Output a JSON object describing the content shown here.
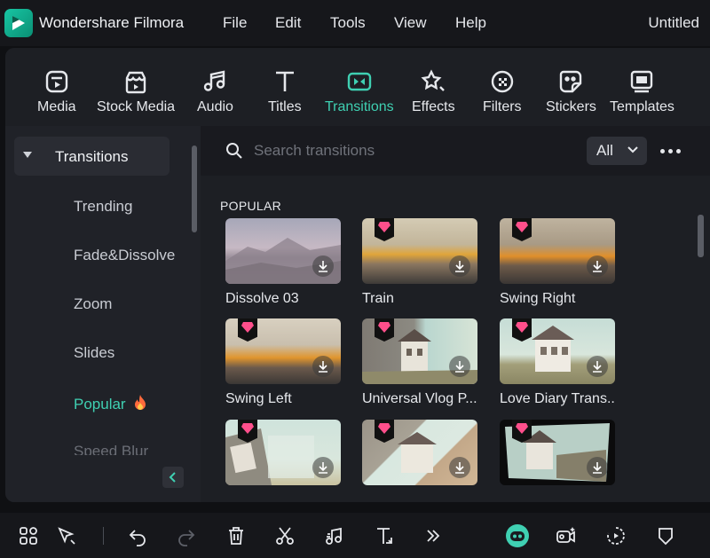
{
  "titlebar": {
    "app_title": "Wondershare Filmora",
    "menu": [
      "File",
      "Edit",
      "Tools",
      "View",
      "Help"
    ],
    "document_title": "Untitled"
  },
  "tabs": [
    {
      "label": "Media",
      "icon": "media-icon",
      "active": false
    },
    {
      "label": "Stock Media",
      "icon": "stock-media-icon",
      "active": false
    },
    {
      "label": "Audio",
      "icon": "audio-icon",
      "active": false
    },
    {
      "label": "Titles",
      "icon": "titles-icon",
      "active": false
    },
    {
      "label": "Transitions",
      "icon": "transitions-icon",
      "active": true
    },
    {
      "label": "Effects",
      "icon": "effects-icon",
      "active": false
    },
    {
      "label": "Filters",
      "icon": "filters-icon",
      "active": false
    },
    {
      "label": "Stickers",
      "icon": "stickers-icon",
      "active": false
    },
    {
      "label": "Templates",
      "icon": "templates-icon",
      "active": false
    }
  ],
  "sidebar": {
    "header": "Transitions",
    "items": [
      "Trending",
      "Fade&Dissolve",
      "Zoom",
      "Slides",
      "Popular",
      "Speed Blur"
    ],
    "active_item": "Popular"
  },
  "search": {
    "placeholder": "Search transitions",
    "filter_value": "All"
  },
  "section": {
    "title": "POPULAR"
  },
  "cards": [
    {
      "label": "Dissolve 03",
      "premium": false
    },
    {
      "label": "Train",
      "premium": true
    },
    {
      "label": "Swing Right",
      "premium": true
    },
    {
      "label": "Swing Left",
      "premium": true
    },
    {
      "label": "Universal Vlog P...",
      "premium": true
    },
    {
      "label": "Love Diary Trans...",
      "premium": true
    },
    {
      "label": "",
      "premium": true
    },
    {
      "label": "",
      "premium": true
    },
    {
      "label": "",
      "premium": true
    }
  ],
  "toolbar_icons": [
    "layout-icon",
    "select-tool-icon",
    "undo-icon",
    "redo-icon",
    "delete-icon",
    "cut-icon",
    "audio-edit-icon",
    "text-icon",
    "more-tools-icon",
    "ai-mate-icon",
    "ai-video-icon",
    "speed-icon",
    "mask-icon"
  ],
  "colors": {
    "accent": "#3fd0b2",
    "premium": "#ff4f8b"
  }
}
